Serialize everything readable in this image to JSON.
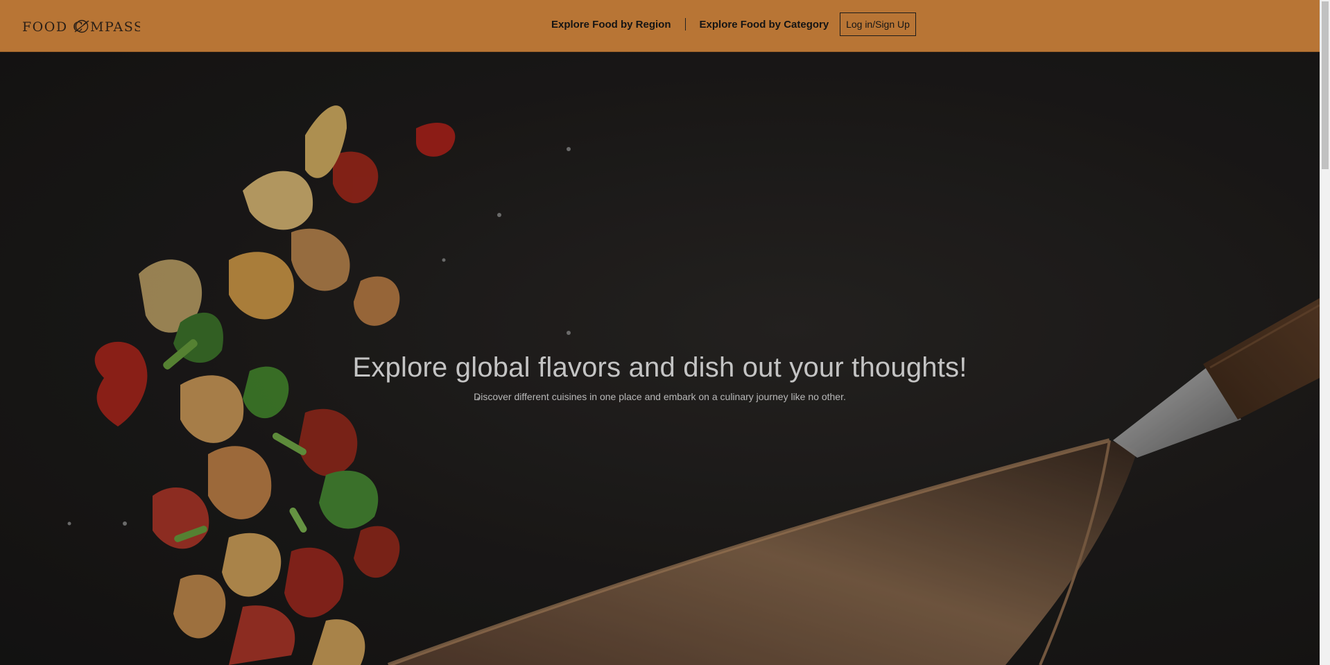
{
  "header": {
    "logo_text": "FOOD COMPASS",
    "nav": {
      "region_label": "Explore Food by Region",
      "category_label": "Explore Food by Category"
    },
    "login_label": "Log in/Sign Up",
    "background_color": "#b87535"
  },
  "hero": {
    "title": "Explore global flavors and dish out your thoughts!",
    "subtitle": "Discover different cuisines in one place and embark on a culinary journey like no other.",
    "image": "stir-fry-vegetables-tossed-from-wok"
  }
}
